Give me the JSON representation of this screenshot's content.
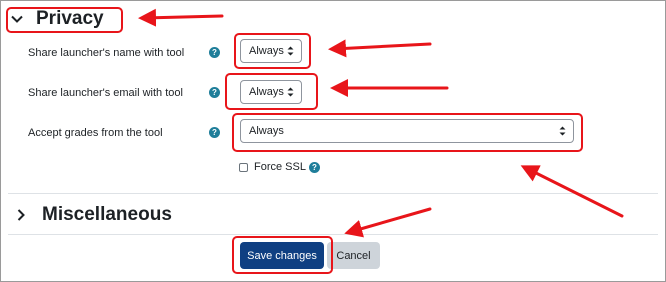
{
  "privacy": {
    "title": "Privacy",
    "rows": [
      {
        "label": "Share launcher's name with tool",
        "value": "Always"
      },
      {
        "label": "Share launcher's email with tool",
        "value": "Always"
      },
      {
        "label": "Accept grades from the tool",
        "value": "Always"
      }
    ],
    "help_glyph": "?",
    "force_ssl_label": "Force SSL"
  },
  "misc": {
    "title": "Miscellaneous"
  },
  "buttons": {
    "save": "Save changes",
    "cancel": "Cancel"
  },
  "colors": {
    "primary": "#0f3f82",
    "help": "#1f7e9a",
    "annotation": "#e8151a"
  },
  "icons": {
    "privacy_toggle": "chevron-down-icon",
    "misc_toggle": "chevron-right-icon",
    "help": "question-circle-icon",
    "select_caret": "up-down-caret-icon"
  }
}
